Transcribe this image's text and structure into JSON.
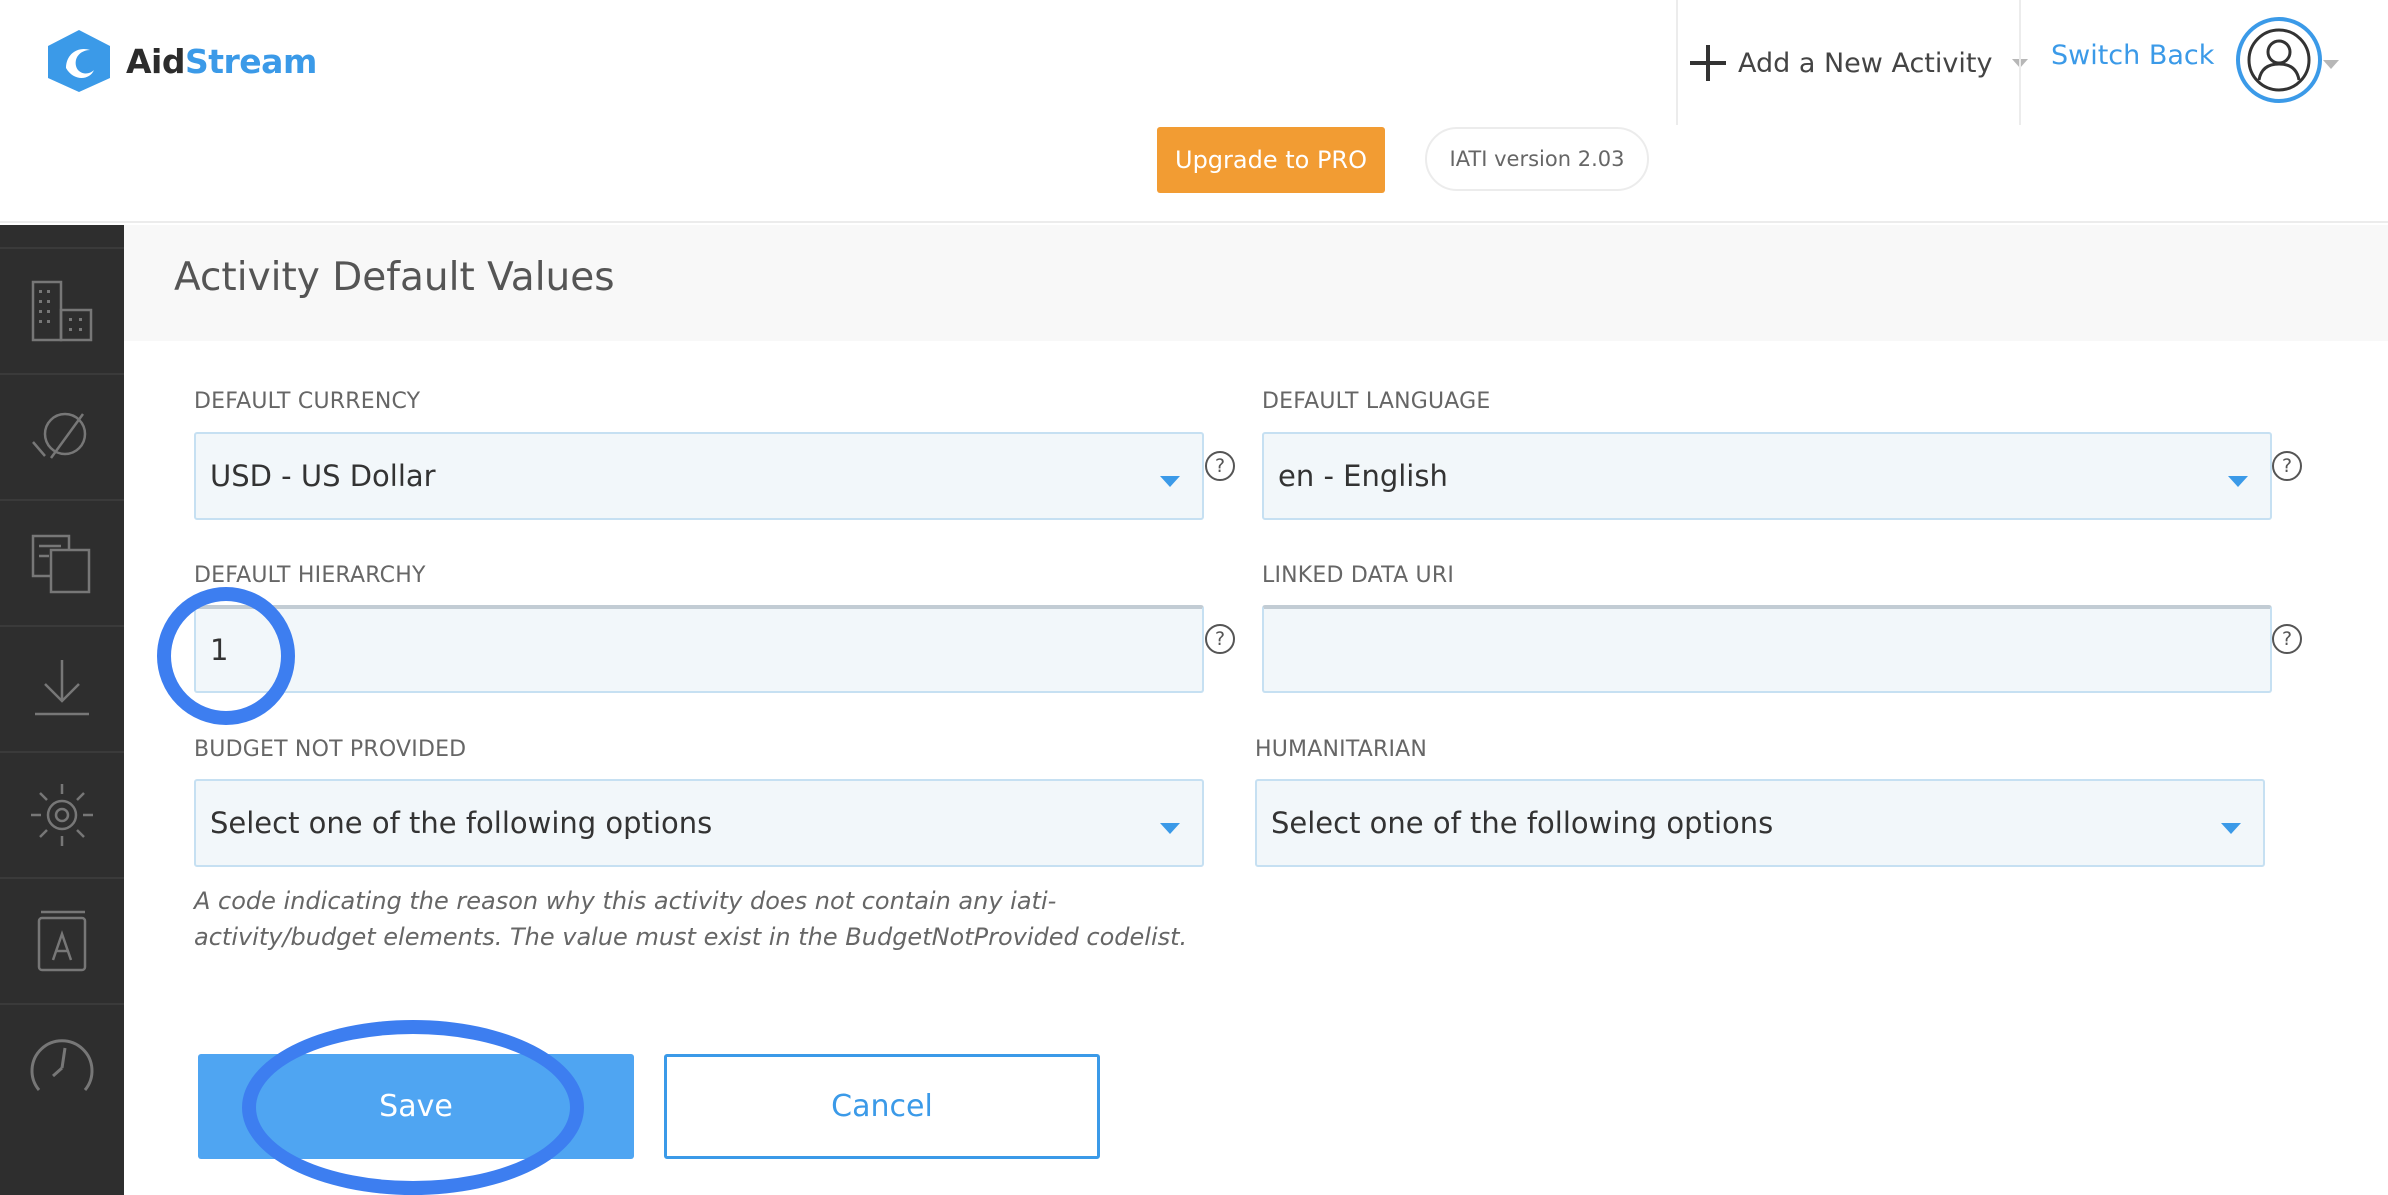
{
  "brand": {
    "name_part1": "Aid",
    "name_part2": "Stream",
    "accent_color": "#3b9ae8",
    "logo_icon": "aidstream-logo-icon"
  },
  "header": {
    "add_activity_label": "Add a New Activity",
    "switch_back_label": "Switch Back",
    "upgrade_label": "Upgrade to PRO",
    "upgrade_color": "#f29c33",
    "iati_version": "IATI version 2.03",
    "avatar_icon": "user-avatar-icon"
  },
  "sidebar": {
    "background": "#2e2e2e",
    "items": [
      {
        "icon": "organization-building-icon"
      },
      {
        "icon": "activities-icon"
      },
      {
        "icon": "documents-icon"
      },
      {
        "icon": "download-icon"
      },
      {
        "icon": "settings-gear-icon"
      },
      {
        "icon": "user-guide-book-icon"
      },
      {
        "icon": "clock-icon"
      }
    ]
  },
  "page": {
    "title": "Activity Default Values"
  },
  "form": {
    "default_currency": {
      "label": "DEFAULT CURRENCY",
      "value": "USD - US Dollar"
    },
    "default_language": {
      "label": "DEFAULT LANGUAGE",
      "value": "en - English"
    },
    "default_hierarchy": {
      "label": "DEFAULT HIERARCHY",
      "value": "1"
    },
    "linked_data_uri": {
      "label": "LINKED DATA URI",
      "value": ""
    },
    "budget_not_provided": {
      "label": "BUDGET NOT PROVIDED",
      "value": "Select one of the following options",
      "help_line1": "A code indicating the reason why this activity does not contain any iati-",
      "help_line2": "activity/budget elements. The value must exist in the BudgetNotProvided codelist."
    },
    "humanitarian": {
      "label": "HUMANITARIAN",
      "value": "Select one of the following options"
    },
    "help_symbol": "?",
    "save_label": "Save",
    "cancel_label": "Cancel"
  },
  "annotations": {
    "ring_color": "#3d7ef0"
  }
}
